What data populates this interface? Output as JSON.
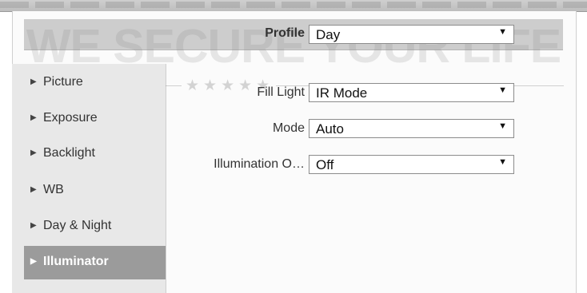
{
  "brand": {
    "watermark": "WE SECURE YOUR LIFE",
    "stars": "★★★★★"
  },
  "profile": {
    "label": "Profile",
    "value": "Day"
  },
  "sidebar": {
    "items": [
      {
        "label": "Picture",
        "active": false
      },
      {
        "label": "Exposure",
        "active": false
      },
      {
        "label": "Backlight",
        "active": false
      },
      {
        "label": "WB",
        "active": false
      },
      {
        "label": "Day & Night",
        "active": false
      },
      {
        "label": "Illuminator",
        "active": true
      }
    ]
  },
  "form": {
    "fill_light": {
      "label": "Fill Light",
      "value": "IR Mode"
    },
    "mode": {
      "label": "Mode",
      "value": "Auto"
    },
    "illumination": {
      "label": "Illumination O…",
      "value": "Off"
    }
  },
  "icons": {
    "dropdown": "▼",
    "chevron": "▶"
  }
}
